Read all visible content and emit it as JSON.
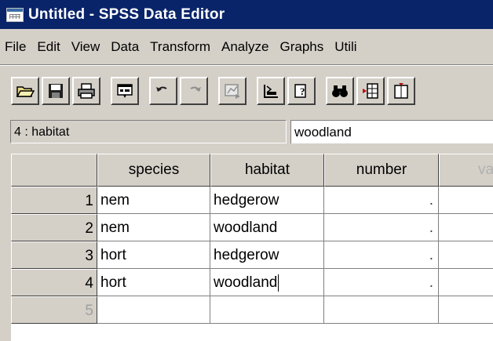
{
  "window": {
    "title": "Untitled - SPSS Data Editor"
  },
  "menu": [
    "File",
    "Edit",
    "View",
    "Data",
    "Transform",
    "Analyze",
    "Graphs",
    "Utili"
  ],
  "toolbar": {
    "buttons": [
      {
        "name": "open-file-button",
        "icon": "folder-open-icon"
      },
      {
        "name": "save-button",
        "icon": "floppy-disk-icon"
      },
      {
        "name": "print-button",
        "icon": "printer-icon"
      },
      {
        "name": "dialog-recall-button",
        "icon": "dialog-recall-icon"
      },
      {
        "name": "undo-button",
        "icon": "undo-icon"
      },
      {
        "name": "redo-button",
        "icon": "redo-icon"
      },
      {
        "name": "goto-chart-button",
        "icon": "chart-goto-icon"
      },
      {
        "name": "goto-case-button",
        "icon": "goto-case-icon"
      },
      {
        "name": "variables-button",
        "icon": "variable-info-icon"
      },
      {
        "name": "find-button",
        "icon": "binoculars-icon"
      },
      {
        "name": "insert-case-button",
        "icon": "insert-case-icon"
      },
      {
        "name": "insert-variable-button",
        "icon": "insert-variable-icon"
      }
    ]
  },
  "cell_editor": {
    "reference": "4 : habitat",
    "value": "woodland"
  },
  "grid": {
    "columns": [
      "species",
      "habitat",
      "number",
      "va"
    ],
    "rows": [
      {
        "num": "1",
        "species": "nem",
        "habitat": "hedgerow",
        "number": "."
      },
      {
        "num": "2",
        "species": "nem",
        "habitat": "woodland",
        "number": "."
      },
      {
        "num": "3",
        "species": "hort",
        "habitat": "hedgerow",
        "number": "."
      },
      {
        "num": "4",
        "species": "hort",
        "habitat": "woodland",
        "number": "."
      },
      {
        "num": "5",
        "species": "",
        "habitat": "",
        "number": ""
      }
    ]
  },
  "colors": {
    "titlebar": "#0a246a",
    "chrome": "#d4d0c8"
  }
}
